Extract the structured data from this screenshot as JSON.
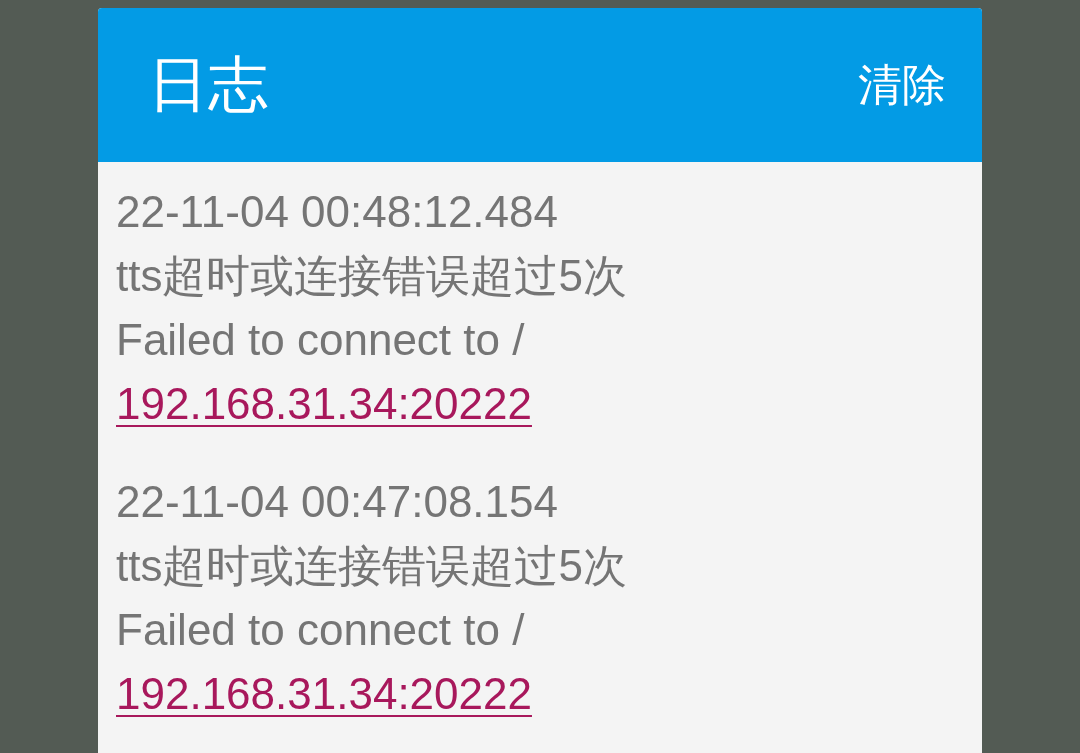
{
  "dialog": {
    "title": "日志",
    "action": "清除",
    "entries": [
      {
        "timestamp": "22-11-04 00:48:12.484",
        "message": "tts超时或连接错误超过5次",
        "error": "Failed to connect to /",
        "link": "192.168.31.34:20222"
      },
      {
        "timestamp": "22-11-04 00:47:08.154",
        "message": "tts超时或连接错误超过5次",
        "error": "Failed to connect to /",
        "link": "192.168.31.34:20222"
      }
    ]
  }
}
